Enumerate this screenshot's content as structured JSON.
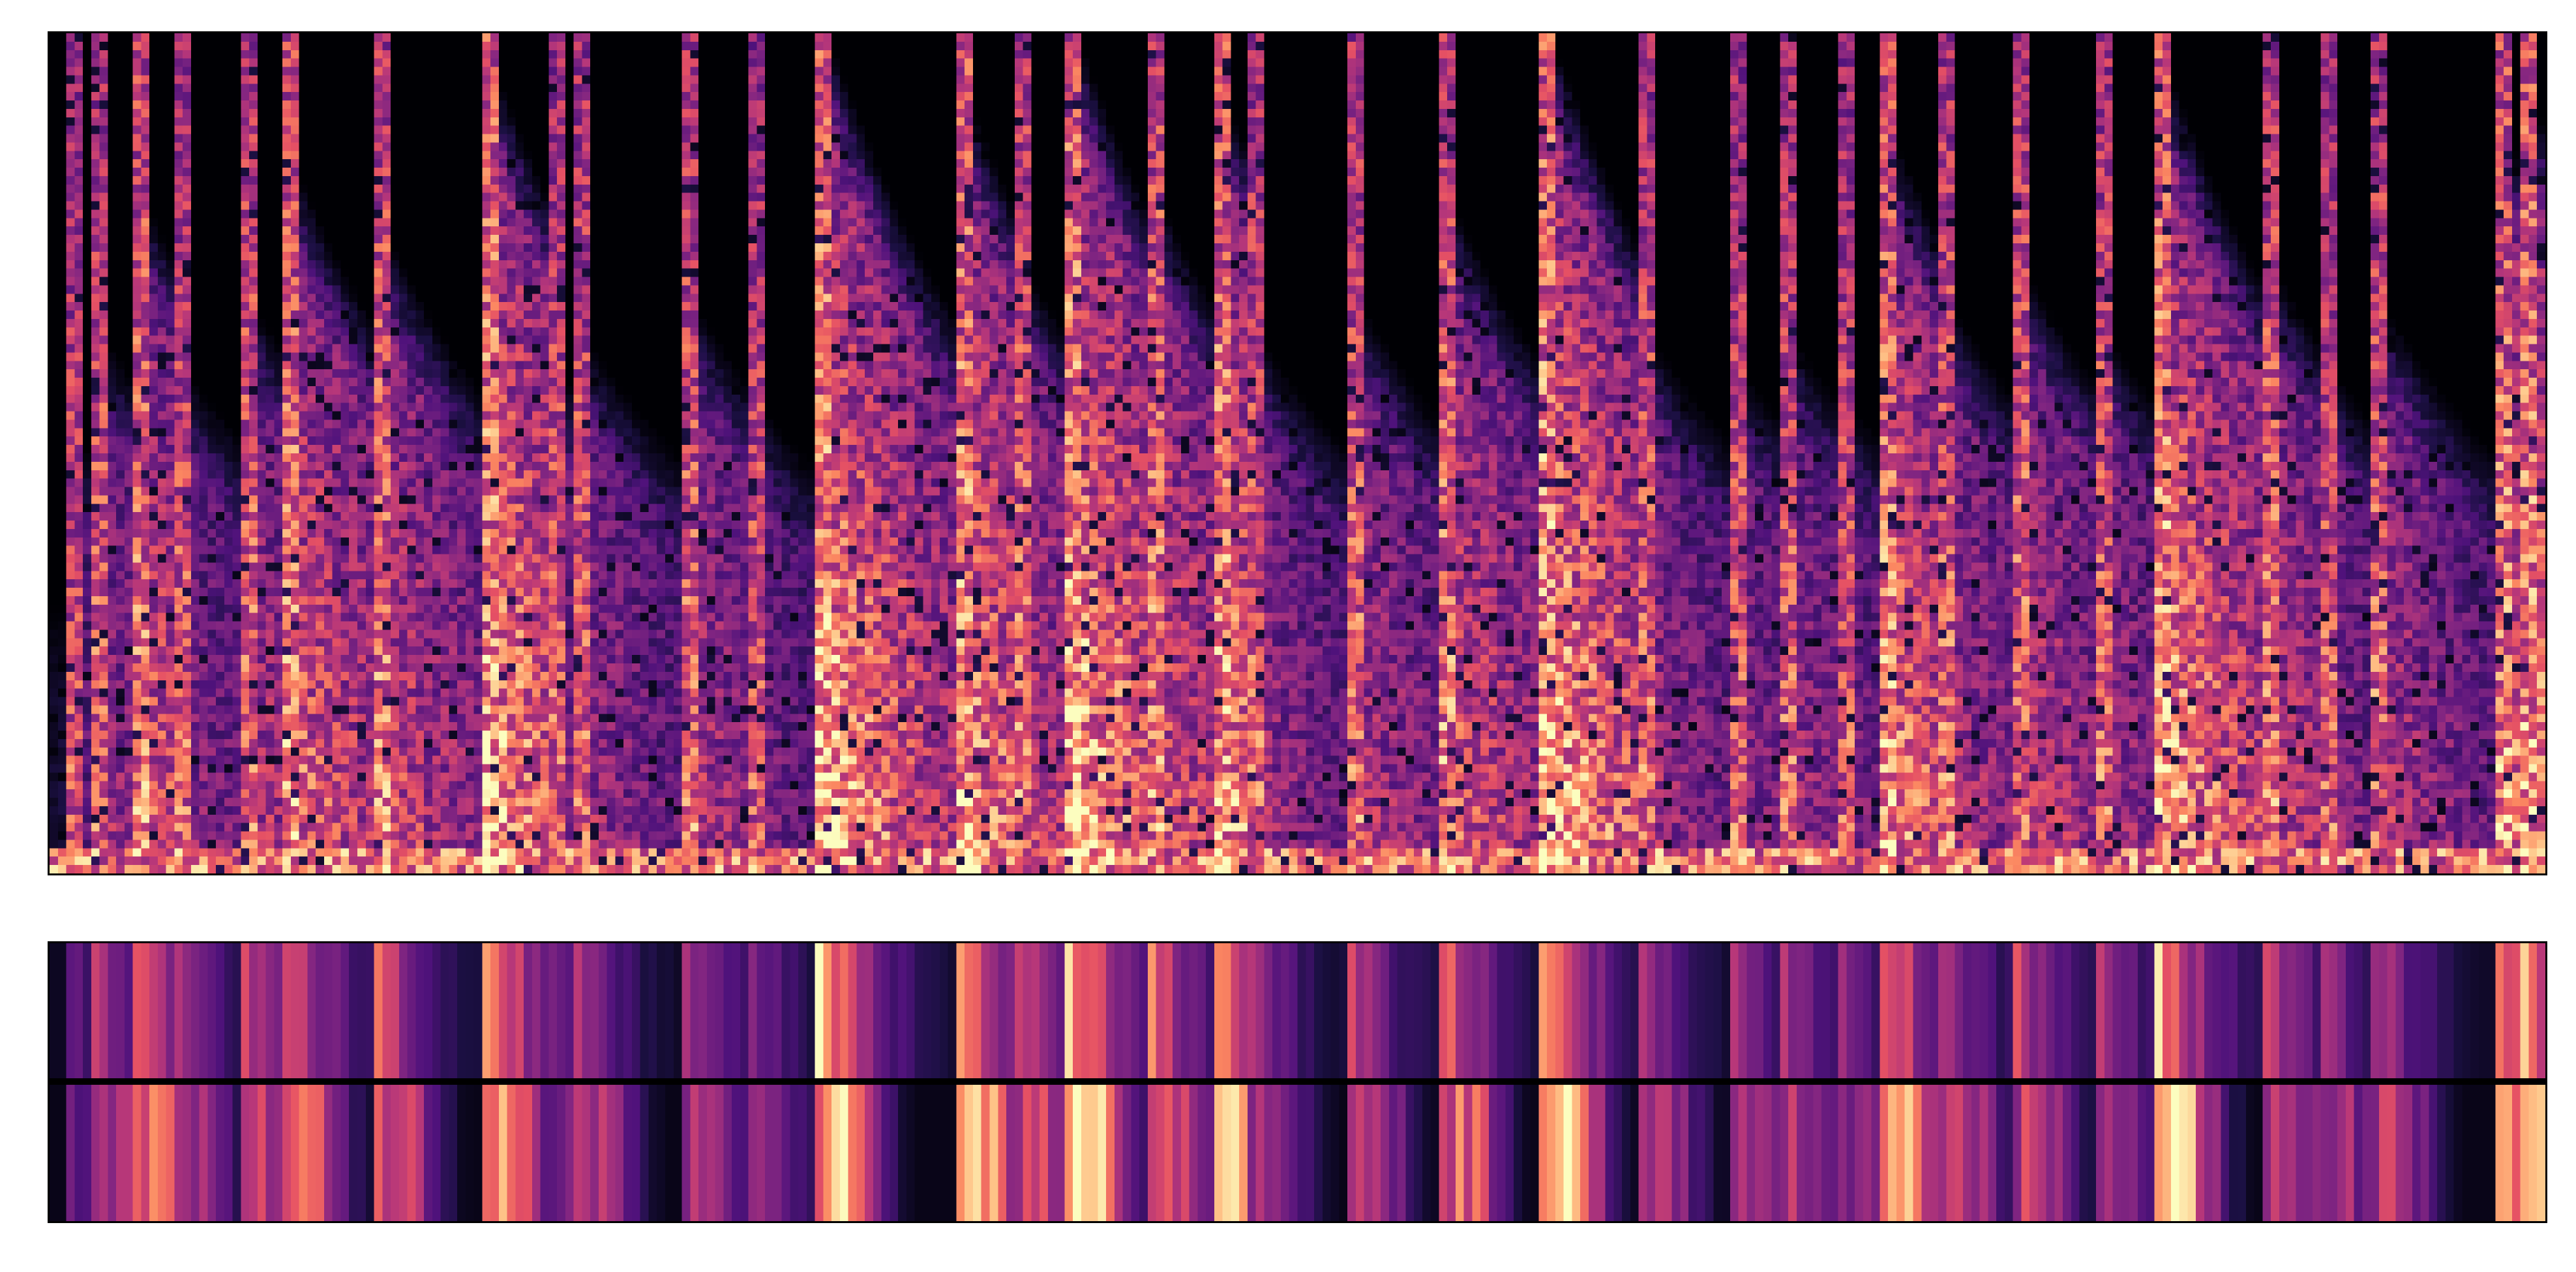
{
  "chart_data": [
    {
      "type": "heatmap",
      "kind": "spectrogram",
      "colormap": "magma",
      "axes_visible": false,
      "time_bins": 300,
      "frequency_bins": 100,
      "onsets": [
        0.006,
        0.016,
        0.032,
        0.051,
        0.075,
        0.094,
        0.131,
        0.174,
        0.2,
        0.21,
        0.253,
        0.28,
        0.307,
        0.362,
        0.387,
        0.407,
        0.44,
        0.467,
        0.48,
        0.52,
        0.557,
        0.598,
        0.635,
        0.672,
        0.692,
        0.716,
        0.733,
        0.758,
        0.786,
        0.82,
        0.843,
        0.885,
        0.91,
        0.93,
        0.98,
        0.99
      ],
      "energies": [
        0.35,
        0.5,
        0.7,
        0.45,
        0.55,
        0.75,
        0.65,
        0.9,
        0.45,
        0.5,
        0.55,
        0.4,
        0.95,
        0.85,
        0.6,
        0.95,
        0.7,
        0.85,
        0.5,
        0.55,
        0.7,
        0.95,
        0.5,
        0.45,
        0.5,
        0.4,
        0.8,
        0.55,
        0.6,
        0.5,
        0.9,
        0.6,
        0.45,
        0.55,
        0.8,
        0.85
      ]
    },
    {
      "type": "heatmap",
      "kind": "onset-strength strips",
      "colormap": "magma",
      "axes_visible": false,
      "rows": 2,
      "columns": 300
    }
  ]
}
